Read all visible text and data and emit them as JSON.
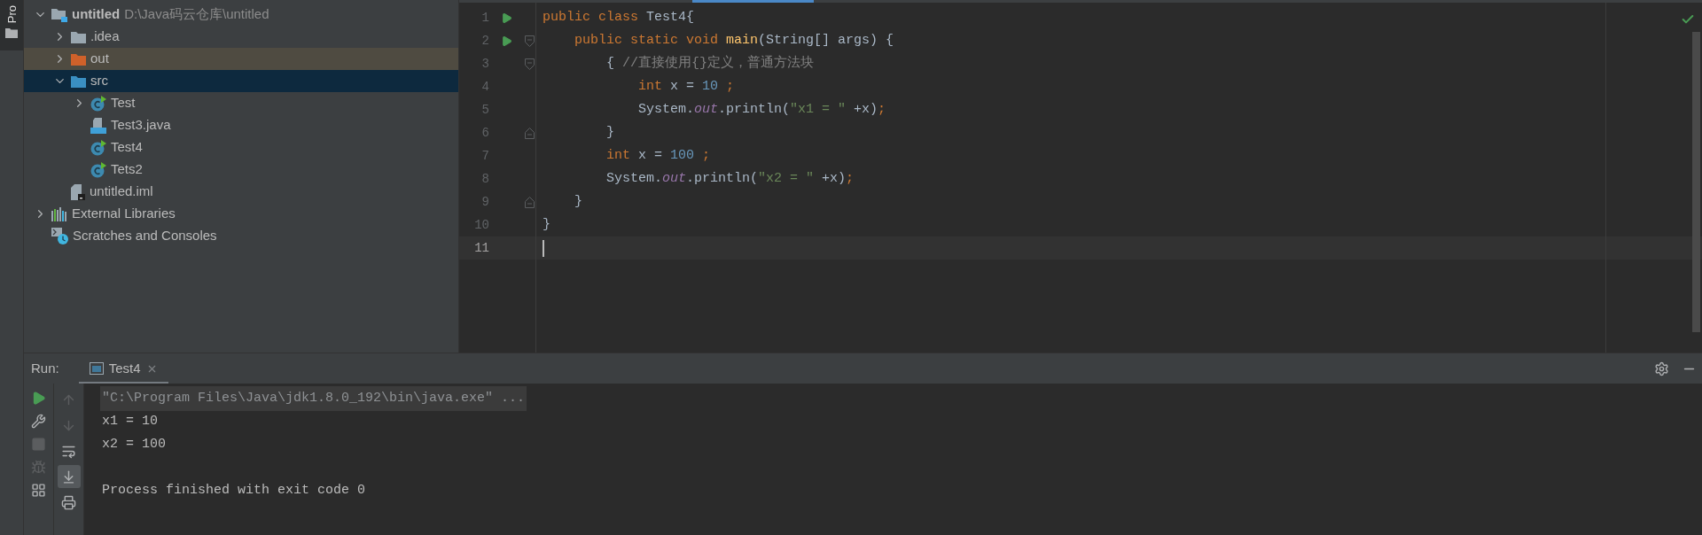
{
  "side_strip": {
    "label": "Pro"
  },
  "project_tree": [
    {
      "name": "untitled",
      "path": "D:\\Java码云仓库\\untitled",
      "kind": "project",
      "expanded": true,
      "selected": false,
      "children": [
        {
          "name": ".idea",
          "kind": "folder",
          "expanded": false,
          "selected": false
        },
        {
          "name": "out",
          "kind": "excluded-folder",
          "expanded": false,
          "selected": false
        },
        {
          "name": "src",
          "kind": "source-folder",
          "expanded": true,
          "selected": true,
          "children": [
            {
              "name": "Test",
              "kind": "class",
              "expanded": false,
              "selected": false
            },
            {
              "name": "Test3.java",
              "kind": "java-file",
              "selected": false
            },
            {
              "name": "Test4",
              "kind": "class",
              "selected": false
            },
            {
              "name": "Tets2",
              "kind": "class",
              "selected": false
            }
          ]
        },
        {
          "name": "untitled.iml",
          "kind": "module-file",
          "selected": false
        }
      ]
    },
    {
      "name": "External Libraries",
      "kind": "libraries",
      "expanded": false,
      "selected": false
    },
    {
      "name": "Scratches and Consoles",
      "kind": "scratches",
      "selected": false
    }
  ],
  "editor": {
    "lines": [
      {
        "number": "1",
        "run": true,
        "current": false,
        "tokens": [
          {
            "kind": "keyword",
            "text": "public class "
          },
          {
            "kind": "plain",
            "text": "Test4{"
          }
        ]
      },
      {
        "number": "2",
        "run": true,
        "fold_marker": {
          "kind": "start"
        },
        "current": false,
        "tokens": [
          {
            "kind": "keyword",
            "text": "    public static void "
          },
          {
            "kind": "method",
            "text": "main"
          },
          {
            "kind": "plain",
            "text": "(String[] args) {"
          }
        ]
      },
      {
        "number": "3",
        "run": false,
        "fold_marker": {
          "kind": "start"
        },
        "current": false,
        "tokens": [
          {
            "kind": "plain",
            "text": "        { "
          },
          {
            "kind": "comment",
            "text": "//直接使用{}定义，普通方法块"
          }
        ]
      },
      {
        "number": "4",
        "run": false,
        "current": false,
        "tokens": [
          {
            "kind": "keyword",
            "text": "            int "
          },
          {
            "kind": "plain",
            "text": "x = "
          },
          {
            "kind": "number",
            "text": "10 "
          },
          {
            "kind": "keyword",
            "text": ";"
          }
        ]
      },
      {
        "number": "5",
        "run": false,
        "current": false,
        "tokens": [
          {
            "kind": "plain",
            "text": "            System."
          },
          {
            "kind": "field",
            "text": "out"
          },
          {
            "kind": "plain",
            "text": ".println("
          },
          {
            "kind": "string",
            "text": "\"x1 = \""
          },
          {
            "kind": "plain",
            "text": " +x)"
          },
          {
            "kind": "keyword",
            "text": ";"
          }
        ]
      },
      {
        "number": "6",
        "run": false,
        "fold_marker": {
          "kind": "end"
        },
        "current": false,
        "tokens": [
          {
            "kind": "plain",
            "text": "        }"
          }
        ]
      },
      {
        "number": "7",
        "run": false,
        "current": false,
        "tokens": [
          {
            "kind": "keyword",
            "text": "        int "
          },
          {
            "kind": "plain",
            "text": "x = "
          },
          {
            "kind": "number",
            "text": "100 "
          },
          {
            "kind": "keyword",
            "text": ";"
          }
        ]
      },
      {
        "number": "8",
        "run": false,
        "current": false,
        "tokens": [
          {
            "kind": "plain",
            "text": "        System."
          },
          {
            "kind": "field",
            "text": "out"
          },
          {
            "kind": "plain",
            "text": ".println("
          },
          {
            "kind": "string",
            "text": "\"x2 = \""
          },
          {
            "kind": "plain",
            "text": " +x)"
          },
          {
            "kind": "keyword",
            "text": ";"
          }
        ]
      },
      {
        "number": "9",
        "run": false,
        "fold_marker": {
          "kind": "end"
        },
        "current": false,
        "tokens": [
          {
            "kind": "plain",
            "text": "    }"
          }
        ]
      },
      {
        "number": "10",
        "run": false,
        "current": false,
        "tokens": [
          {
            "kind": "plain",
            "text": "}"
          }
        ]
      },
      {
        "number": "11",
        "run": false,
        "current": true
      }
    ]
  },
  "run_panel": {
    "label": "Run:",
    "tabs": [
      {
        "label": "Test4",
        "selected": true
      }
    ],
    "left_tools": [
      {
        "kind": "rerun",
        "disabled": false
      },
      {
        "kind": "wrench",
        "disabled": false
      },
      {
        "kind": "stop",
        "disabled": true
      },
      {
        "kind": "debug",
        "disabled": true
      },
      {
        "kind": "layout",
        "disabled": false
      }
    ],
    "right_tools": [
      {
        "kind": "up",
        "disabled": true,
        "selected": false
      },
      {
        "kind": "down",
        "disabled": true,
        "selected": false
      },
      {
        "kind": "wrap",
        "disabled": false,
        "selected": false
      },
      {
        "kind": "scroll-end",
        "disabled": false,
        "selected": true
      },
      {
        "kind": "print",
        "disabled": false,
        "selected": false
      }
    ],
    "console": [
      {
        "kind": "command",
        "text": "\"C:\\Program Files\\Java\\jdk1.8.0_192\\bin\\java.exe\" ..."
      },
      {
        "kind": "output",
        "text": "x1 = 10"
      },
      {
        "kind": "output",
        "text": "x2 = 100"
      },
      {
        "kind": "status",
        "text": "Process finished with exit code 0"
      }
    ]
  }
}
